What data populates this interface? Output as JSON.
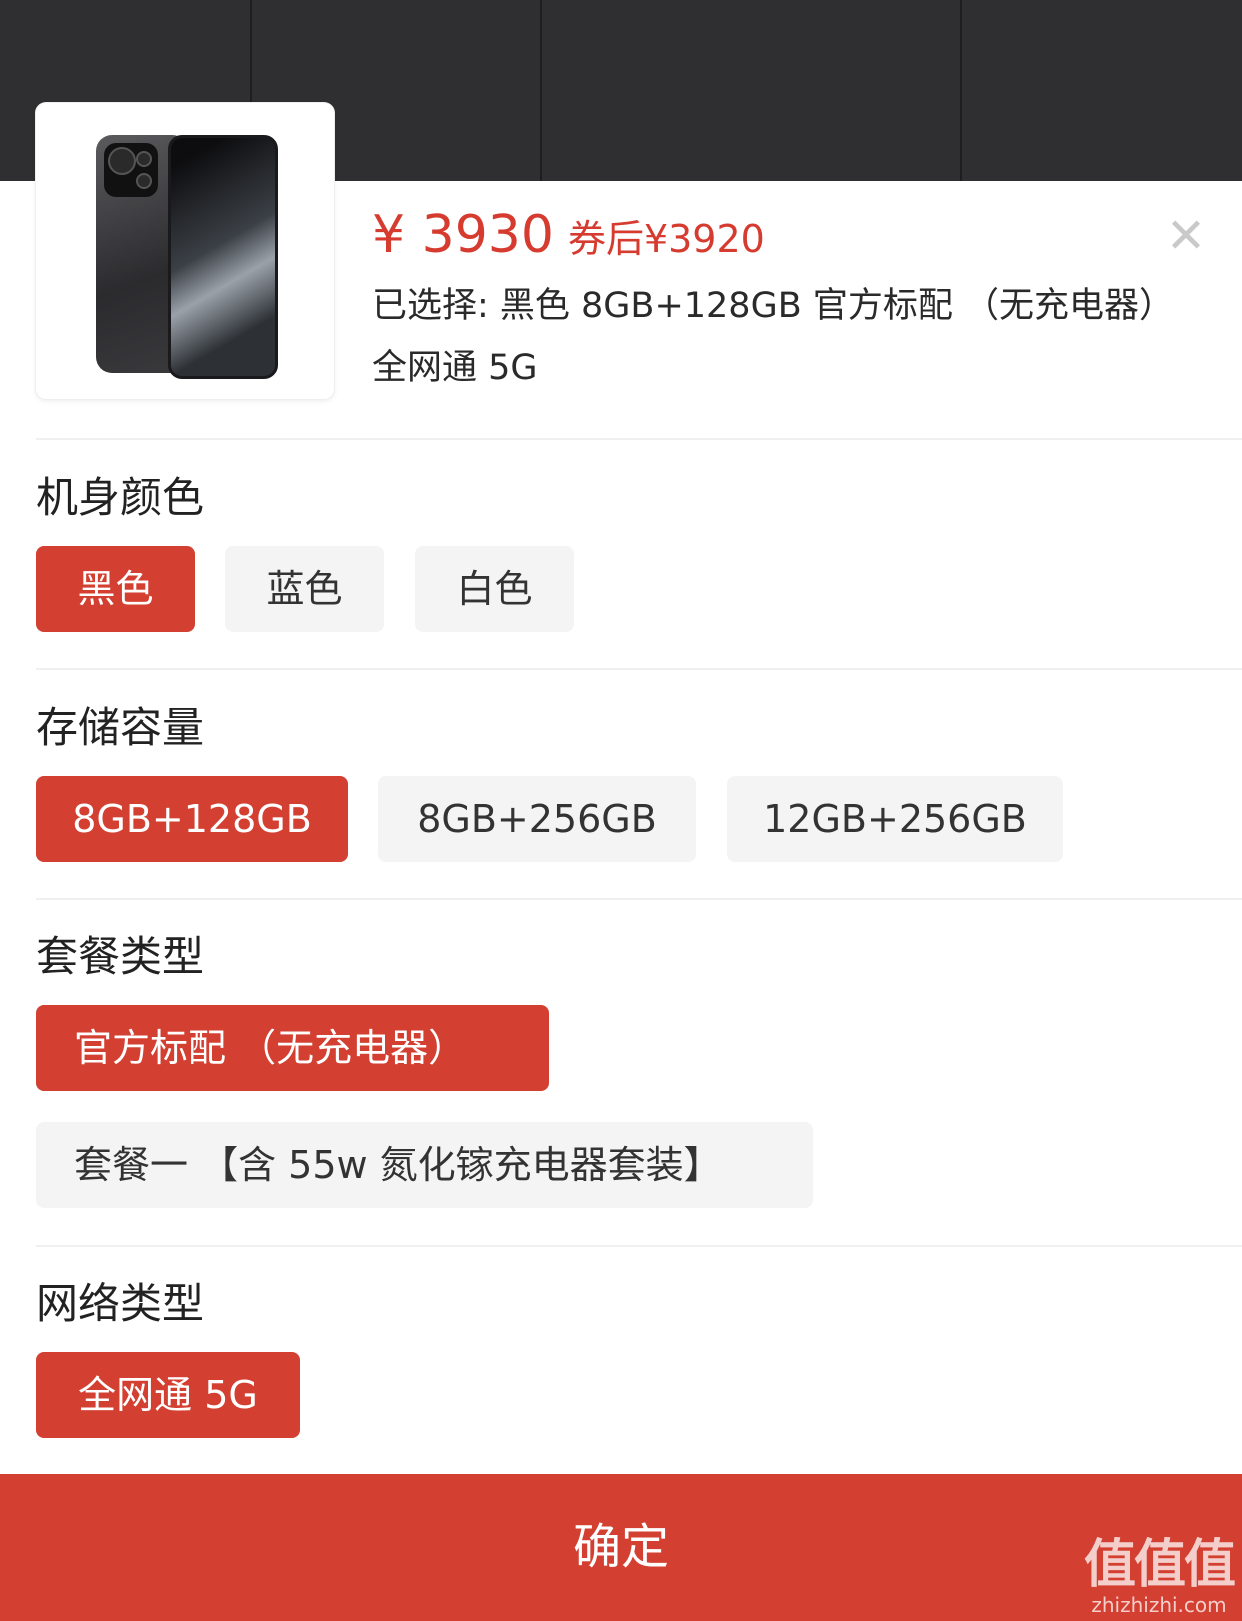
{
  "product": {
    "price": "¥ 3930",
    "after_coupon": "券后¥3920",
    "selected_text": "已选择: 黑色 8GB+128GB 官方标配 （无充电器） 全网通 5G",
    "close_icon": "close-icon"
  },
  "sections": {
    "color": {
      "title": "机身颜色",
      "options": [
        "黑色",
        "蓝色",
        "白色"
      ],
      "selected": "黑色"
    },
    "storage": {
      "title": "存储容量",
      "options": [
        "8GB+128GB",
        "8GB+256GB",
        "12GB+256GB"
      ],
      "selected": "8GB+128GB"
    },
    "package": {
      "title": "套餐类型",
      "options": [
        "官方标配 （无充电器）",
        "套餐一 【含 55w 氮化镓充电器套装】"
      ],
      "selected": "官方标配 （无充电器）"
    },
    "network": {
      "title": "网络类型",
      "options": [
        "全网通 5G"
      ],
      "selected": "全网通 5G"
    }
  },
  "confirm_label": "确定",
  "watermark": {
    "logo": "值值值",
    "site": "zhizhizhi.com"
  },
  "colors": {
    "accent": "#d33f31",
    "price": "#d63b2f",
    "chip_bg": "#f4f4f4"
  }
}
